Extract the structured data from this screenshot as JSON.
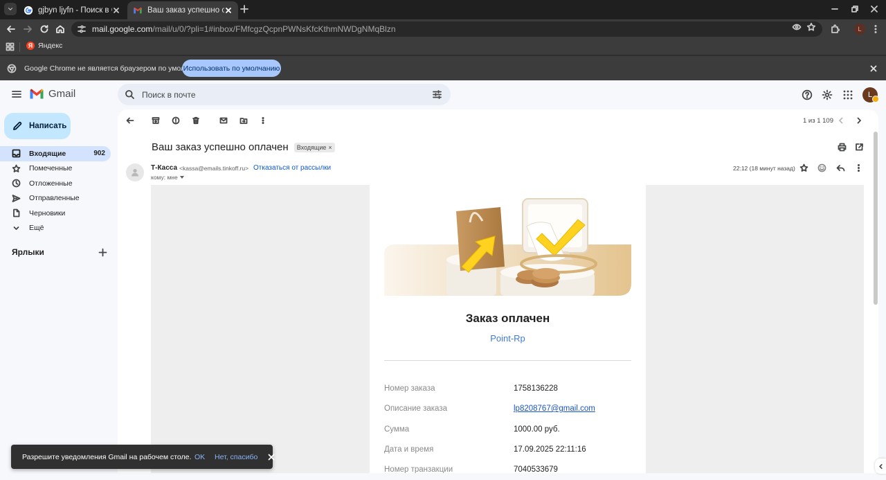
{
  "browser": {
    "tabs": [
      {
        "title": "gjbyn ljyfn - Поиск в Google"
      },
      {
        "title": "Ваш заказ успешно оплачен - "
      }
    ],
    "url_host": "mail.google.com",
    "url_path": "/mail/u/0/?pli=1#inbox/FMfcgzQcpnPWNsKfcKthmNWDgNMqBlzn",
    "profile_initial": "L",
    "bookmark": {
      "label": "Яндекс",
      "logo_letter": "Я"
    },
    "infobar": {
      "text": "Google Chrome не является браузером по умолчанию.",
      "button": "Использовать по умолчанию"
    }
  },
  "gmail": {
    "app_name": "Gmail",
    "search_placeholder": "Поиск в почте",
    "avatar_initial": "L",
    "compose_label": "Написать",
    "nav": [
      {
        "label": "Входящие",
        "count": "902",
        "icon": "inbox-icon"
      },
      {
        "label": "Помеченные",
        "icon": "star-icon"
      },
      {
        "label": "Отложенные",
        "icon": "clock-icon"
      },
      {
        "label": "Отправленные",
        "icon": "send-icon"
      },
      {
        "label": "Черновики",
        "icon": "draft-icon"
      },
      {
        "label": "Ещё",
        "icon": "chevron-down-icon"
      }
    ],
    "labels_heading": "Ярлыки",
    "pager": "1 из 1 109",
    "message": {
      "subject": "Ваш заказ успешно оплачен",
      "chip": "Входящие",
      "sender_name": "Т-Касса",
      "sender_email": "<kassa@emails.tinkoff.ru>",
      "unsubscribe": "Отказаться от рассылки",
      "to": "кому: мне",
      "time": "22:12 (18 минут назад)"
    },
    "receipt": {
      "title": "Заказ оплачен",
      "merchant": "Point-Rp",
      "rows": [
        {
          "label": "Номер заказа",
          "value": "1758136228"
        },
        {
          "label": "Описание заказа",
          "value": "lp8208767@gmail.com"
        },
        {
          "label": "Сумма",
          "value": "1000.00 руб."
        },
        {
          "label": "Дата и время",
          "value": "17.09.2025 22:11:16"
        },
        {
          "label": "Номер транзакции",
          "value": "7040533679"
        }
      ]
    },
    "toast": {
      "text": "Разрешите уведомления Gmail на рабочем столе.",
      "ok": "OK",
      "no": "Нет, спасибо"
    }
  },
  "colors": {
    "accent": "#0b57d0",
    "selected_nav": "#d3e3fd",
    "compose": "#c2e7ff",
    "chrome_dark": "#1f1f1f",
    "chrome_toolbar": "#3c3c3c"
  }
}
